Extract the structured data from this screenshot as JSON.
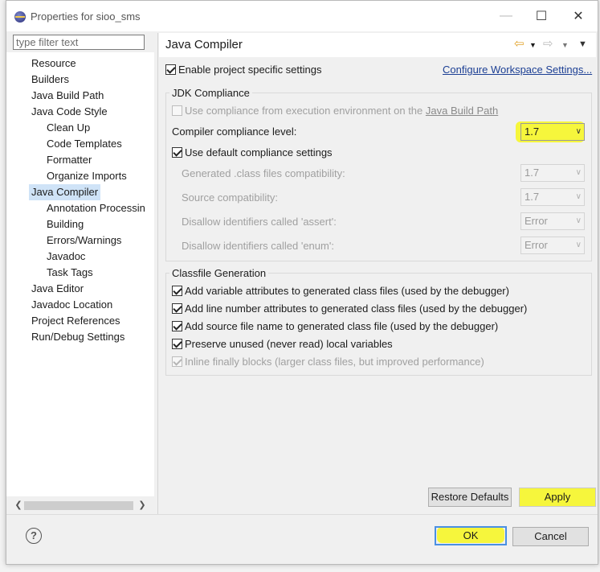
{
  "window": {
    "title": "Properties for sioo_sms"
  },
  "filter": {
    "placeholder": "type filter text"
  },
  "tree": {
    "items": [
      {
        "label": "Resource"
      },
      {
        "label": "Builders"
      },
      {
        "label": "Java Build Path"
      },
      {
        "label": "Java Code Style"
      },
      {
        "label": "Clean Up"
      },
      {
        "label": "Code Templates"
      },
      {
        "label": "Formatter"
      },
      {
        "label": "Organize Imports"
      },
      {
        "label": "Java Compiler"
      },
      {
        "label": "Annotation Processin"
      },
      {
        "label": "Building"
      },
      {
        "label": "Errors/Warnings"
      },
      {
        "label": "Javadoc"
      },
      {
        "label": "Task Tags"
      },
      {
        "label": "Java Editor"
      },
      {
        "label": "Javadoc Location"
      },
      {
        "label": "Project References"
      },
      {
        "label": "Run/Debug Settings"
      }
    ]
  },
  "page": {
    "title": "Java Compiler",
    "enable_specific": "Enable project specific settings",
    "configure_link": "Configure Workspace Settings..."
  },
  "jdk": {
    "group_title": "JDK Compliance",
    "use_env_prefix": "Use compliance from execution environment on the ",
    "use_env_link": "Java Build Path",
    "compliance_label": "Compiler compliance level:",
    "compliance_value": "1.7",
    "use_default": "Use default compliance settings",
    "generated_label": "Generated .class files compatibility:",
    "generated_value": "1.7",
    "source_label": "Source compatibility:",
    "source_value": "1.7",
    "assert_label": "Disallow identifiers called 'assert':",
    "assert_value": "Error",
    "enum_label": "Disallow identifiers called 'enum':",
    "enum_value": "Error"
  },
  "classfile": {
    "group_title": "Classfile Generation",
    "opt1": "Add variable attributes to generated class files (used by the debugger)",
    "opt2": "Add line number attributes to generated class files (used by the debugger)",
    "opt3": "Add source file name to generated class file (used by the debugger)",
    "opt4": "Preserve unused (never read) local variables",
    "opt5": "Inline finally blocks (larger class files, but improved performance)"
  },
  "buttons": {
    "restore": "Restore Defaults",
    "apply": "Apply",
    "ok": "OK",
    "cancel": "Cancel",
    "help": "?"
  },
  "colors": {
    "highlight": "#f6f63c",
    "selection": "#cfe3f7",
    "link": "#1c3f94",
    "default_border": "#4a90e2"
  }
}
